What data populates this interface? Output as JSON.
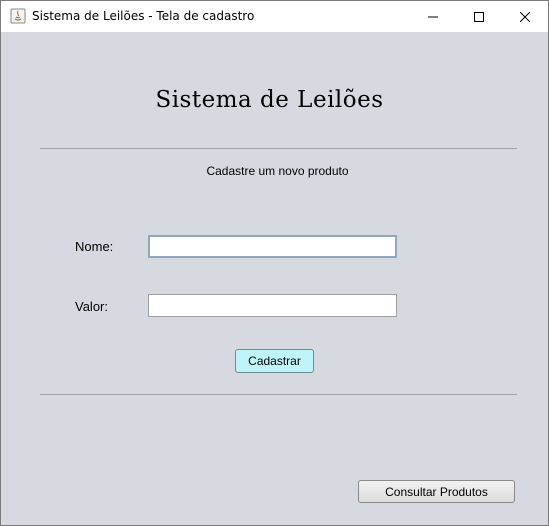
{
  "window": {
    "title": "Sistema de Leilões - Tela de cadastro",
    "controls": [
      "minimize-icon",
      "maximize-icon",
      "close-icon"
    ]
  },
  "form": {
    "heading": "Sistema de Leilões",
    "subtitle": "Cadastre um novo produto",
    "nome_label": "Nome:",
    "nome_value": "",
    "valor_label": "Valor:",
    "valor_value": "",
    "cadastrar_label": "Cadastrar"
  },
  "footer": {
    "consultar_label": "Consultar Produtos"
  },
  "colors": {
    "background": "#d6d9df",
    "cadastrar_button": "#bff4f8",
    "focused_border": "#8fa8c0"
  }
}
